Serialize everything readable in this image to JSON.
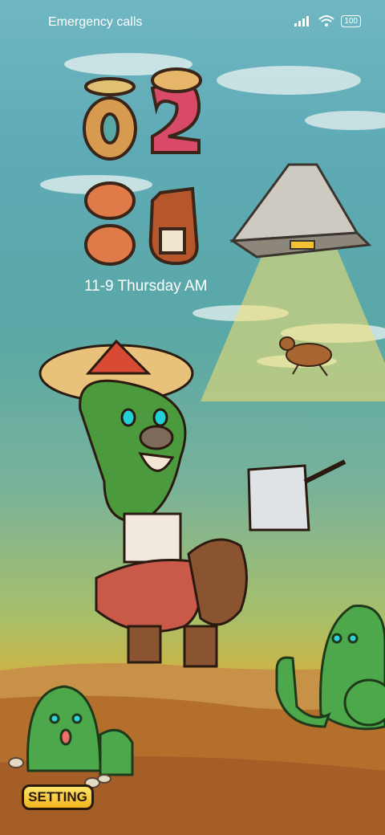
{
  "status_bar": {
    "carrier_text": "Emergency calls",
    "battery_level": "100",
    "signal_icon": "cell-signal-icon",
    "wifi_icon": "wifi-icon"
  },
  "clock": {
    "hour": "02",
    "minute": "36"
  },
  "date_line": "11-9 Thursday AM",
  "setting_button": {
    "label": "SETTING"
  },
  "colors": {
    "sky": "#6fb7c2",
    "ground": "#b8702e",
    "cactus": "#4ca84a",
    "button": "#f2c12a"
  }
}
